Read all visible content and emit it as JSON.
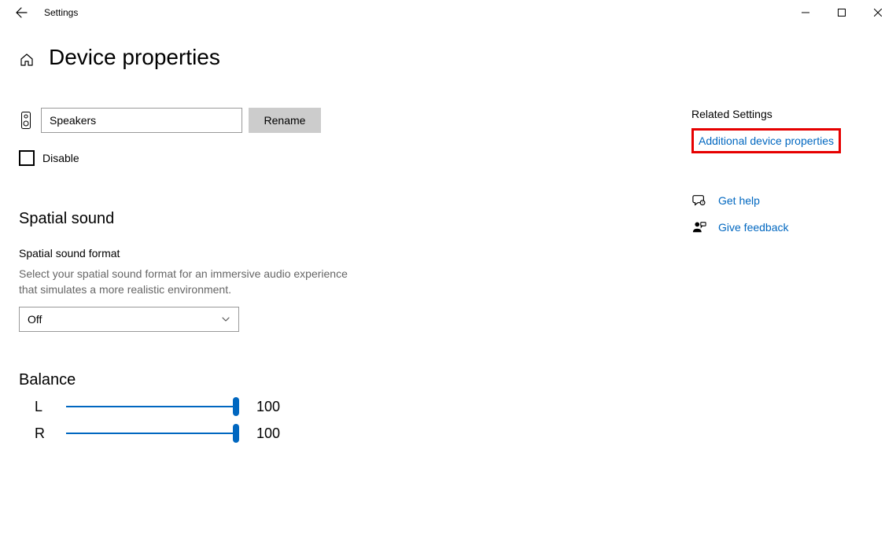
{
  "titlebar": {
    "app_name": "Settings"
  },
  "header": {
    "page_title": "Device properties"
  },
  "device": {
    "name_value": "Speakers",
    "rename_label": "Rename",
    "disable_label": "Disable"
  },
  "spatial": {
    "section_title": "Spatial sound",
    "format_label": "Spatial sound format",
    "description": "Select your spatial sound format for an immersive audio experience that simulates a more realistic environment.",
    "selected_option": "Off"
  },
  "balance": {
    "section_title": "Balance",
    "left_letter": "L",
    "left_value": "100",
    "right_letter": "R",
    "right_value": "100"
  },
  "related": {
    "title": "Related Settings",
    "additional_link": "Additional device properties",
    "help_link": "Get help",
    "feedback_link": "Give feedback"
  }
}
